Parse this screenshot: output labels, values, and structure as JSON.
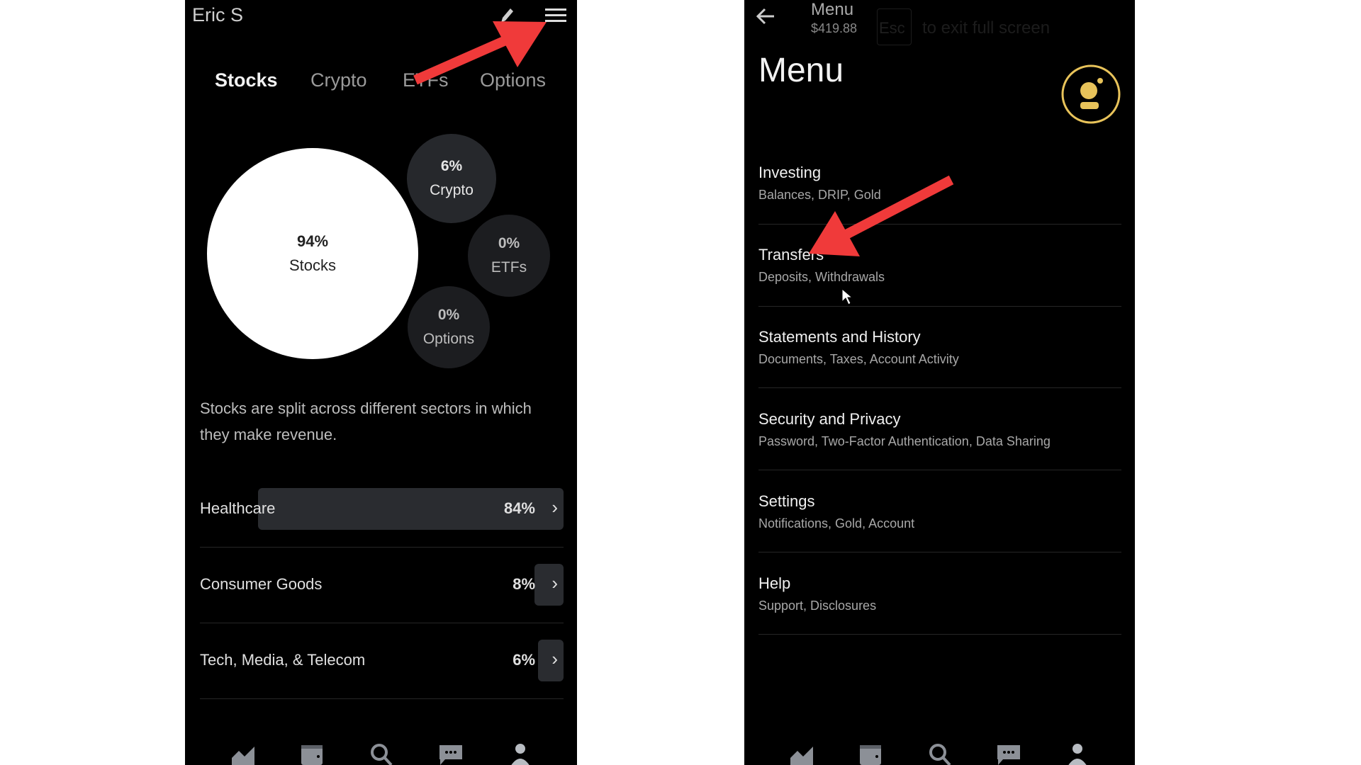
{
  "left_screen": {
    "user_name": "Eric S",
    "icons": {
      "edit": "pencil-icon",
      "menu": "hamburger-menu-icon"
    },
    "tabs": [
      {
        "label": "Stocks",
        "active": true
      },
      {
        "label": "Crypto",
        "active": false
      },
      {
        "label": "ETFs",
        "active": false
      },
      {
        "label": "Options",
        "active": false
      }
    ],
    "allocation": [
      {
        "percent": "94%",
        "label": "Stocks"
      },
      {
        "percent": "6%",
        "label": "Crypto"
      },
      {
        "percent": "0%",
        "label": "ETFs"
      },
      {
        "percent": "0%",
        "label": "Options"
      }
    ],
    "description": "Stocks are split across different sectors in which they make revenue.",
    "sectors": [
      {
        "name": "Healthcare",
        "percent": "84%",
        "value": 84
      },
      {
        "name": "Consumer Goods",
        "percent": "8%",
        "value": 8
      },
      {
        "name": "Tech, Media, & Telecom",
        "percent": "6%",
        "value": 6
      }
    ],
    "bottom_nav": [
      "chart-icon",
      "wallet-icon",
      "search-icon",
      "chat-icon",
      "profile-icon"
    ]
  },
  "right_screen": {
    "header": {
      "title": "Menu",
      "balance": "$419.88"
    },
    "fullscreen_hint": {
      "key": "Esc",
      "text": "to exit full screen"
    },
    "title": "Menu",
    "avatar_color": "#e8c35a",
    "items": [
      {
        "title": "Investing",
        "subtitle": "Balances, DRIP, Gold"
      },
      {
        "title": "Transfers",
        "subtitle": "Deposits, Withdrawals"
      },
      {
        "title": "Statements and History",
        "subtitle": "Documents, Taxes, Account Activity"
      },
      {
        "title": "Security and Privacy",
        "subtitle": "Password, Two-Factor Authentication, Data Sharing"
      },
      {
        "title": "Settings",
        "subtitle": "Notifications, Gold, Account"
      },
      {
        "title": "Help",
        "subtitle": "Support, Disclosures"
      }
    ],
    "bottom_nav": [
      "chart-icon",
      "wallet-icon",
      "search-icon",
      "chat-icon",
      "profile-icon"
    ]
  },
  "annotation_color": "#f03a3a"
}
